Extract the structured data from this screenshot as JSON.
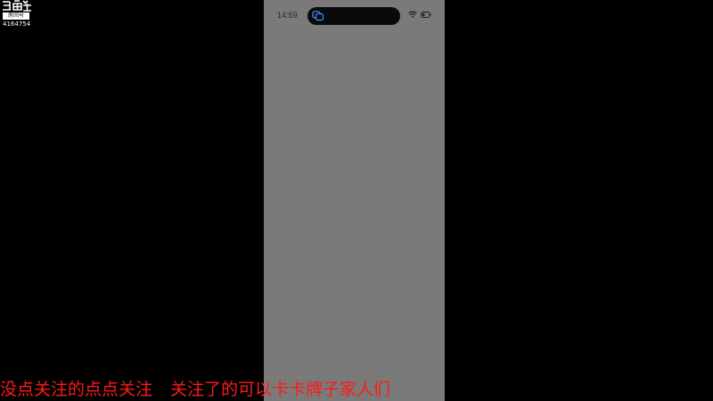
{
  "watermark": {
    "logo_text": "斗鱼",
    "room_label": "房间号",
    "room_id": "4164754"
  },
  "phone": {
    "status_bar": {
      "time": "14:59",
      "island_icon": "copy-icon",
      "wifi_icon": "wifi-icon",
      "battery_icon": "battery-icon"
    },
    "screen_color": "#7a7a7a"
  },
  "subtitle": {
    "part1": "没点关注的点点关注",
    "part2": "关注了的可以卡卡牌子家人们",
    "color": "#ff1a1a"
  }
}
